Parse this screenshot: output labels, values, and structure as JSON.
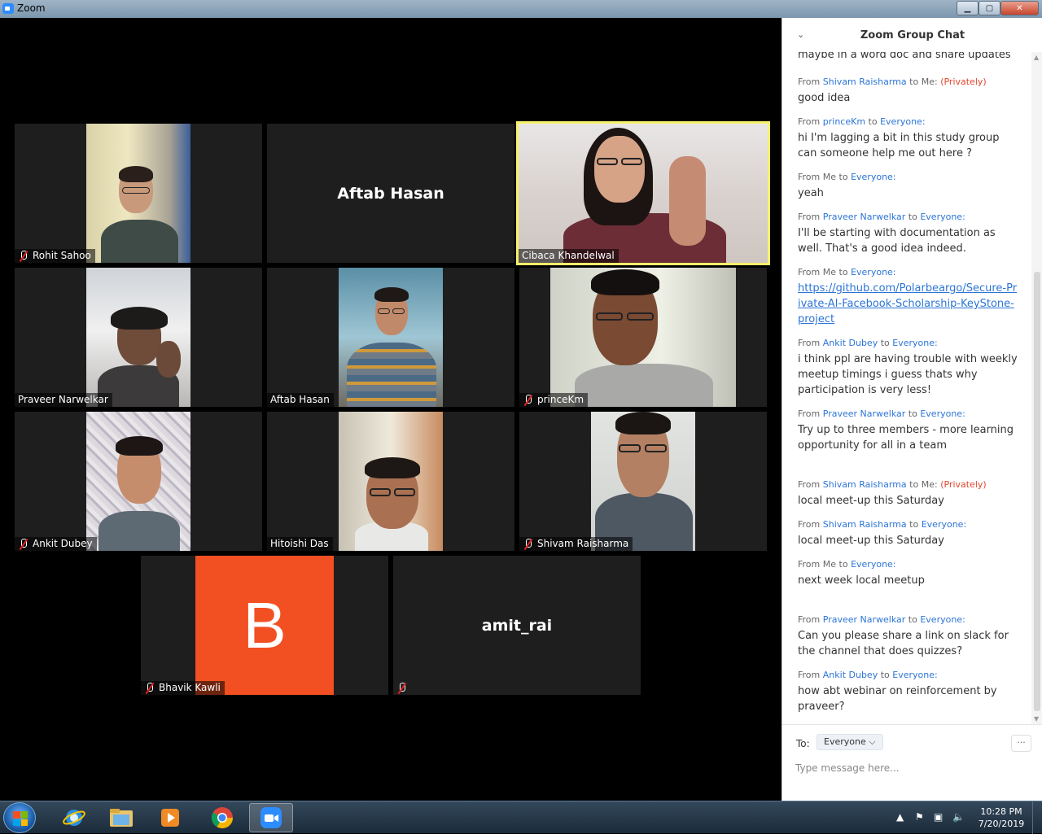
{
  "window": {
    "title": "Zoom",
    "minimize": "▁",
    "maximize": "▢",
    "close": "✕"
  },
  "tiles": [
    {
      "name": "Rohit Sahoo",
      "muted": true
    },
    {
      "name": "Aftab Hasan",
      "muted": false,
      "center_label": "Aftab Hasan"
    },
    {
      "name": "Cibaca Khandelwal",
      "muted": false,
      "active_speaker": true
    },
    {
      "name": "Praveer Narwelkar",
      "muted": false
    },
    {
      "name": "Aftab Hasan",
      "muted": false
    },
    {
      "name": "princeKm",
      "muted": true
    },
    {
      "name": "Ankit Dubey",
      "muted": true
    },
    {
      "name": "Hitoishi Das",
      "muted": false
    },
    {
      "name": "Shivam Raisharma",
      "muted": true
    },
    {
      "name": "Bhavik Kawli",
      "muted": true,
      "avatar_letter": "B",
      "avatar_color": "#f25022"
    },
    {
      "name": "",
      "muted": true,
      "center_label": "amit_rai"
    }
  ],
  "chat": {
    "title": "Zoom Group Chat",
    "messages": [
      {
        "from": "",
        "to": "",
        "private": false,
        "text": "maybe in a word doc and share updates"
      },
      {
        "from": "Shivam Raisharma",
        "to": "Me:",
        "private": true,
        "text": "good idea"
      },
      {
        "from": "princeKm",
        "to": "Everyone:",
        "private": false,
        "text": "hi I'm lagging a bit in this study group can someone help me out here ?"
      },
      {
        "from": "Me",
        "to": "Everyone:",
        "private": false,
        "text": "yeah"
      },
      {
        "from": "Praveer Narwelkar",
        "to": "Everyone:",
        "private": false,
        "text": "I'll be starting with documentation as well. That's a good idea indeed."
      },
      {
        "from": "Me",
        "to": "Everyone:",
        "private": false,
        "text": "https://github.com/Polarbeargo/Secure-Private-AI-Facebook-Scholarship-KeyStone-project",
        "is_link": true
      },
      {
        "from": "Ankit Dubey",
        "to": "Everyone:",
        "private": false,
        "text": "i think ppl are having trouble with weekly meetup timings i guess thats why participation is very less!"
      },
      {
        "from": "Praveer Narwelkar",
        "to": "Everyone:",
        "private": false,
        "text": "Try up to three members - more learning opportunity for all in a team"
      },
      {
        "from": "Shivam Raisharma",
        "to": "Me:",
        "private": true,
        "text": "local meet-up this Saturday"
      },
      {
        "from": "Shivam Raisharma",
        "to": "Everyone:",
        "private": false,
        "text": "local meet-up this Saturday"
      },
      {
        "from": "Me",
        "to": "Everyone:",
        "private": false,
        "text": "next week local meetup"
      },
      {
        "from": "Praveer Narwelkar",
        "to": "Everyone:",
        "private": false,
        "text": "Can you please share a link on slack for the channel that does quizzes?"
      },
      {
        "from": "Ankit Dubey",
        "to": "Everyone:",
        "private": false,
        "text": "how abt webinar on reinforcement by praveer?"
      }
    ],
    "labels": {
      "from": "From",
      "to": "to",
      "privately": "(Privately)"
    },
    "footer": {
      "to_label": "To:",
      "recipient": "Everyone ⌵",
      "more": "···",
      "placeholder": "Type message here..."
    }
  },
  "taskbar": {
    "apps": [
      "internet-explorer",
      "file-explorer",
      "media-player",
      "chrome",
      "zoom"
    ],
    "clock_time": "10:28 PM",
    "clock_date": "7/20/2019"
  }
}
